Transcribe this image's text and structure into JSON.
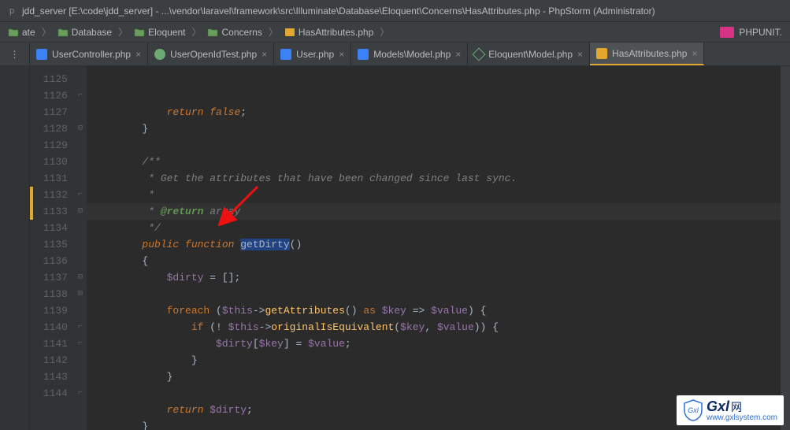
{
  "window": {
    "title": "jdd_server [E:\\code\\jdd_server] - ...\\vendor\\laravel\\framework\\src\\Illuminate\\Database\\Eloquent\\Concerns\\HasAttributes.php - PhpStorm (Administrator)"
  },
  "breadcrumbs": {
    "items": [
      {
        "label": "ate",
        "type": "folder"
      },
      {
        "label": "Database",
        "type": "folder"
      },
      {
        "label": "Eloquent",
        "type": "folder"
      },
      {
        "label": "Concerns",
        "type": "folder"
      },
      {
        "label": "HasAttributes.php",
        "type": "php"
      }
    ],
    "right_tool": "PHPUNIT."
  },
  "tabs": [
    {
      "label": "UserController.php",
      "icon": "php-blue",
      "active": false
    },
    {
      "label": "UserOpenIdTest.php",
      "icon": "php-green",
      "active": false
    },
    {
      "label": "User.php",
      "icon": "php-blue",
      "active": false
    },
    {
      "label": "Models\\Model.php",
      "icon": "php-blue",
      "active": false
    },
    {
      "label": "Eloquent\\Model.php",
      "icon": "cube-green",
      "active": false
    },
    {
      "label": "HasAttributes.php",
      "icon": "php-orange",
      "active": true
    }
  ],
  "editor": {
    "current_line_index": 8,
    "modified_ranges": [
      {
        "start_index": 7,
        "end_index": 8
      }
    ],
    "lines": [
      {
        "n": 1125,
        "fold": "",
        "tokens": [
          {
            "t": "            ",
            "c": ""
          },
          {
            "t": "return ",
            "c": "kw"
          },
          {
            "t": "false",
            "c": "kw"
          },
          {
            "t": ";",
            "c": "op"
          }
        ]
      },
      {
        "n": 1126,
        "fold": "end",
        "tokens": [
          {
            "t": "        }",
            "c": "op"
          }
        ]
      },
      {
        "n": 1127,
        "fold": "",
        "tokens": []
      },
      {
        "n": 1128,
        "fold": "open",
        "tokens": [
          {
            "t": "        /**",
            "c": "com"
          }
        ]
      },
      {
        "n": 1129,
        "fold": "",
        "tokens": [
          {
            "t": "         * Get the attributes that have been changed since last sync.",
            "c": "com"
          }
        ]
      },
      {
        "n": 1130,
        "fold": "",
        "tokens": [
          {
            "t": "         *",
            "c": "com"
          }
        ]
      },
      {
        "n": 1131,
        "fold": "",
        "tokens": [
          {
            "t": "         * ",
            "c": "com"
          },
          {
            "t": "@return",
            "c": "doctag"
          },
          {
            "t": " array",
            "c": "com"
          }
        ]
      },
      {
        "n": 1132,
        "fold": "end",
        "tokens": [
          {
            "t": "         */",
            "c": "com"
          }
        ]
      },
      {
        "n": 1133,
        "fold": "open",
        "tokens": [
          {
            "t": "        ",
            "c": ""
          },
          {
            "t": "public ",
            "c": "kw"
          },
          {
            "t": "function ",
            "c": "kw"
          },
          {
            "t": "getDirty",
            "c": "hl-sel fn-def"
          },
          {
            "t": "()",
            "c": "paren"
          }
        ]
      },
      {
        "n": 1134,
        "fold": "",
        "tokens": [
          {
            "t": "        {",
            "c": "op"
          }
        ]
      },
      {
        "n": 1135,
        "fold": "",
        "tokens": [
          {
            "t": "            ",
            "c": ""
          },
          {
            "t": "$dirty",
            "c": "var"
          },
          {
            "t": " = [];",
            "c": "op"
          }
        ]
      },
      {
        "n": 1136,
        "fold": "",
        "tokens": []
      },
      {
        "n": 1137,
        "fold": "open",
        "tokens": [
          {
            "t": "            ",
            "c": ""
          },
          {
            "t": "foreach ",
            "c": "kw2"
          },
          {
            "t": "(",
            "c": "paren"
          },
          {
            "t": "$this",
            "c": "var"
          },
          {
            "t": "->",
            "c": "op"
          },
          {
            "t": "getAttributes",
            "c": "fn"
          },
          {
            "t": "() ",
            "c": "paren"
          },
          {
            "t": "as ",
            "c": "kw2"
          },
          {
            "t": "$key",
            "c": "var"
          },
          {
            "t": " => ",
            "c": "op"
          },
          {
            "t": "$value",
            "c": "var"
          },
          {
            "t": ") {",
            "c": "op"
          }
        ]
      },
      {
        "n": 1138,
        "fold": "open",
        "tokens": [
          {
            "t": "                ",
            "c": ""
          },
          {
            "t": "if ",
            "c": "kw2"
          },
          {
            "t": "(! ",
            "c": "op"
          },
          {
            "t": "$this",
            "c": "var"
          },
          {
            "t": "->",
            "c": "op"
          },
          {
            "t": "originalIsEquivalent",
            "c": "fn"
          },
          {
            "t": "(",
            "c": "paren"
          },
          {
            "t": "$key",
            "c": "var"
          },
          {
            "t": ", ",
            "c": "op"
          },
          {
            "t": "$value",
            "c": "var"
          },
          {
            "t": ")) {",
            "c": "op"
          }
        ]
      },
      {
        "n": 1139,
        "fold": "",
        "tokens": [
          {
            "t": "                    ",
            "c": ""
          },
          {
            "t": "$dirty",
            "c": "var"
          },
          {
            "t": "[",
            "c": "op"
          },
          {
            "t": "$key",
            "c": "var"
          },
          {
            "t": "] = ",
            "c": "op"
          },
          {
            "t": "$value",
            "c": "var"
          },
          {
            "t": ";",
            "c": "op"
          }
        ]
      },
      {
        "n": 1140,
        "fold": "end",
        "tokens": [
          {
            "t": "                }",
            "c": "op"
          }
        ]
      },
      {
        "n": 1141,
        "fold": "end",
        "tokens": [
          {
            "t": "            }",
            "c": "op"
          }
        ]
      },
      {
        "n": 1142,
        "fold": "",
        "tokens": []
      },
      {
        "n": 1143,
        "fold": "",
        "tokens": [
          {
            "t": "            ",
            "c": ""
          },
          {
            "t": "return ",
            "c": "kw"
          },
          {
            "t": "$dirty",
            "c": "var"
          },
          {
            "t": ";",
            "c": "op"
          }
        ]
      },
      {
        "n": 1144,
        "fold": "end",
        "tokens": [
          {
            "t": "        }",
            "c": "op"
          }
        ]
      }
    ]
  },
  "watermark": {
    "brand": "Gxl",
    "suffix": "网",
    "url": "www.gxlsystem.com",
    "shield_text": "Gxl"
  }
}
